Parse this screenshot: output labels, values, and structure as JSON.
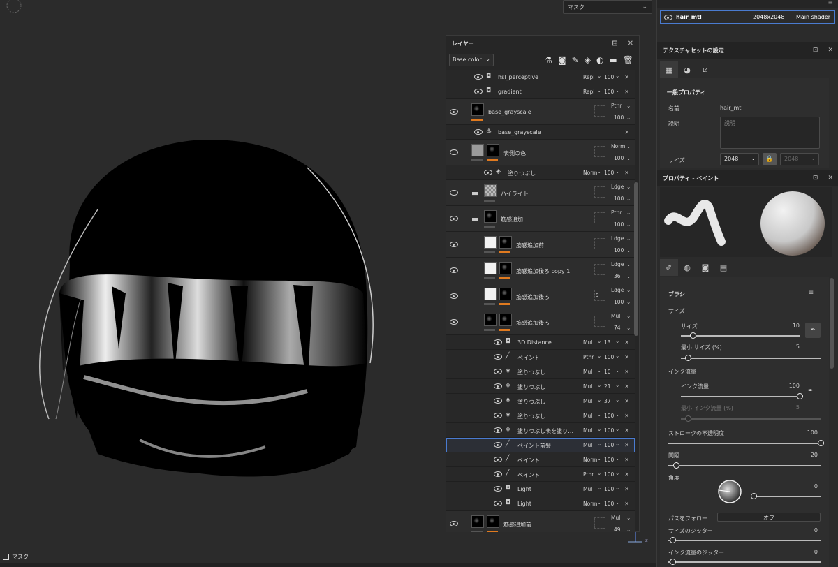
{
  "viewport": {
    "mask_dropdown": "マスク",
    "bottom_label": "マスク",
    "axis_label": "z"
  },
  "layers_panel": {
    "title": "レイヤー",
    "channel": "Base color",
    "rows": [
      {
        "kind": "sub",
        "name": "hsl_perceptive",
        "blend": "Repl",
        "opacity": "100",
        "icon": "filter-icon",
        "visible": true,
        "indent": 2
      },
      {
        "kind": "sub",
        "name": "gradient",
        "blend": "Repl",
        "opacity": "100",
        "icon": "filter-icon",
        "visible": true,
        "indent": 2
      },
      {
        "kind": "main",
        "name": "base_grayscale",
        "blend": "Pthr",
        "opacity": "100",
        "thumb": "black",
        "mask": false,
        "visible": true,
        "folder": false
      },
      {
        "kind": "sub",
        "name": "base_grayscale",
        "blend": "",
        "opacity": "",
        "icon": "anchor-icon",
        "visible": true,
        "indent": 2
      },
      {
        "kind": "main",
        "name": "表側の色",
        "blend": "Norm",
        "opacity": "100",
        "thumb": "grey",
        "mask": true,
        "visible": false,
        "folder": false
      },
      {
        "kind": "sub",
        "name": "塗りつぶし",
        "blend": "Norm",
        "opacity": "100",
        "icon": "fill-icon",
        "visible": true,
        "indent": 3
      },
      {
        "kind": "main",
        "name": "ハイライト",
        "blend": "Ldge",
        "opacity": "100",
        "thumb": "check",
        "mask": false,
        "visible": false,
        "folder": true
      },
      {
        "kind": "main",
        "name": "筋感追加",
        "blend": "Pthr",
        "opacity": "100",
        "thumb": "black",
        "mask": false,
        "visible": true,
        "folder": true
      },
      {
        "kind": "main",
        "name": "筋感追加前",
        "blend": "Ldge",
        "opacity": "100",
        "thumb": "white",
        "mask": true,
        "visible": true,
        "folder": false,
        "indent": 1
      },
      {
        "kind": "main",
        "name": "筋感追加後ろ copy 1",
        "blend": "Ldge",
        "opacity": "36",
        "thumb": "white",
        "mask": true,
        "visible": true,
        "folder": false,
        "indent": 1
      },
      {
        "kind": "main",
        "name": "筋感追加後ろ",
        "blend": "Ldge",
        "opacity": "100",
        "thumb": "white",
        "mask": true,
        "visible": true,
        "folder": false,
        "indent": 1,
        "badge": "9"
      },
      {
        "kind": "main",
        "name": "筋感追加後ろ",
        "blend": "Mul",
        "opacity": "74",
        "thumb": "black",
        "mask": true,
        "visible": true,
        "folder": false,
        "indent": 1
      },
      {
        "kind": "sub",
        "name": "3D Distance",
        "blend": "Mul",
        "opacity": "13",
        "icon": "filter-icon",
        "visible": true,
        "indent": 4
      },
      {
        "kind": "sub",
        "name": "ペイント",
        "blend": "Pthr",
        "opacity": "100",
        "icon": "brush-icon",
        "visible": true,
        "indent": 4
      },
      {
        "kind": "sub",
        "name": "塗りつぶし",
        "blend": "Mul",
        "opacity": "10",
        "icon": "fill-icon",
        "visible": true,
        "indent": 4
      },
      {
        "kind": "sub",
        "name": "塗りつぶし",
        "blend": "Mul",
        "opacity": "21",
        "icon": "fill-icon",
        "visible": true,
        "indent": 4
      },
      {
        "kind": "sub",
        "name": "塗りつぶし",
        "blend": "Mul",
        "opacity": "37",
        "icon": "fill-icon",
        "visible": true,
        "indent": 4
      },
      {
        "kind": "sub",
        "name": "塗りつぶし",
        "blend": "Mul",
        "opacity": "100",
        "icon": "fill-icon",
        "visible": true,
        "indent": 4
      },
      {
        "kind": "sub",
        "name": "塗りつぶし表を塗り…",
        "blend": "Mul",
        "opacity": "100",
        "icon": "fill-icon",
        "visible": true,
        "indent": 4
      },
      {
        "kind": "sub",
        "name": "ペイント前髪",
        "blend": "Mul",
        "opacity": "100",
        "icon": "brush-icon",
        "visible": true,
        "indent": 4,
        "selected": true
      },
      {
        "kind": "sub",
        "name": "ペイント",
        "blend": "Norm",
        "opacity": "100",
        "icon": "brush-icon",
        "visible": true,
        "indent": 4
      },
      {
        "kind": "sub",
        "name": "ペイント",
        "blend": "Pthr",
        "opacity": "100",
        "icon": "brush-icon",
        "visible": true,
        "indent": 4
      },
      {
        "kind": "sub",
        "name": "Light",
        "blend": "Mul",
        "opacity": "100",
        "icon": "filter-icon",
        "visible": true,
        "indent": 4
      },
      {
        "kind": "sub",
        "name": "Light",
        "blend": "Norm",
        "opacity": "100",
        "icon": "filter-icon",
        "visible": true,
        "indent": 4
      },
      {
        "kind": "main",
        "name": "筋感追加前",
        "blend": "Mul",
        "opacity": "49",
        "thumb": "black",
        "mask": true,
        "visible": true,
        "folder": false
      }
    ]
  },
  "material": {
    "name": "hair_mtl",
    "resolution": "2048x2048",
    "shader": "Main shader"
  },
  "texture_set": {
    "title": "テクスチャセットの設定",
    "section": "一般プロパティ",
    "name_label": "名前",
    "name_value": "hair_mtl",
    "desc_label": "説明",
    "desc_placeholder": "説明",
    "size_label": "サイズ",
    "size_value": "2048",
    "size_value2": "2048"
  },
  "paint": {
    "title": "プロパティ - ペイント",
    "brush_section": "ブラシ",
    "size_group": "サイズ",
    "size_label": "サイズ",
    "size_value": "10",
    "size_pct": 0.1,
    "min_size_label": "最小 サイズ (%)",
    "min_size_value": "5",
    "min_size_pct": 0.05,
    "flow_group": "インク流量",
    "flow_label": "インク流量",
    "flow_value": "100",
    "flow_pct": 1.0,
    "min_flow_label": "最小 インク流量 (%)",
    "min_flow_value": "5",
    "min_flow_pct": 0.05,
    "opacity_label": "ストロークの不透明度",
    "opacity_value": "100",
    "opacity_pct": 1.0,
    "spacing_label": "間隔",
    "spacing_value": "20",
    "spacing_pct": 0.05,
    "angle_label": "角度",
    "angle_value": "0",
    "angle_pct": 0.0,
    "follow_label": "パスをフォロー",
    "follow_value": "オフ",
    "size_jitter_label": "サイズのジッター",
    "size_jitter_value": "0",
    "flow_jitter_label": "インク流量のジッター",
    "flow_jitter_value": "0"
  }
}
